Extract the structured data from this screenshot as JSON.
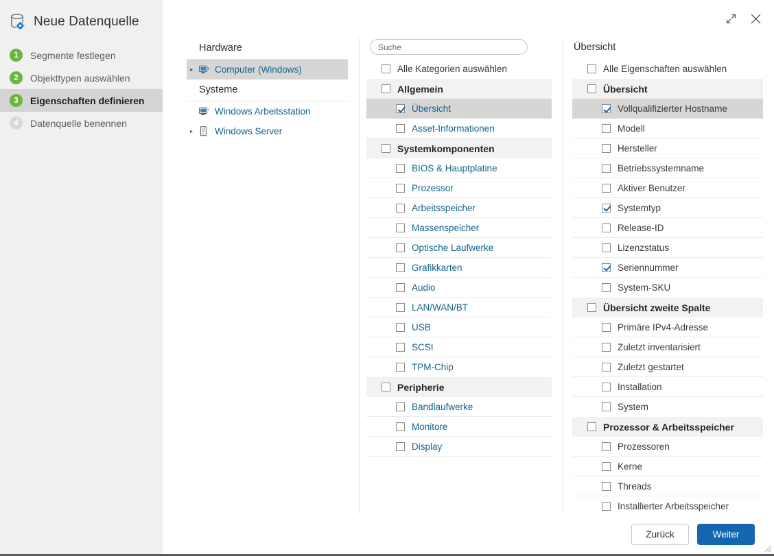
{
  "window": {
    "title": "Neue Datenquelle",
    "title_icon": "database-gear-icon",
    "maximize_icon": "maximize-icon",
    "close_icon": "close-icon"
  },
  "sidebar": {
    "steps": [
      {
        "number": "1",
        "label": "Segmente festlegen",
        "state": "done"
      },
      {
        "number": "2",
        "label": "Objekttypen auswählen",
        "state": "done"
      },
      {
        "number": "3",
        "label": "Eigenschaften definieren",
        "state": "active"
      },
      {
        "number": "4",
        "label": "Datenquelle benennen",
        "state": "pending"
      }
    ]
  },
  "tree": {
    "groups": [
      {
        "header": "Hardware",
        "items": [
          {
            "label": "Computer (Windows)",
            "icon": "computer-icon",
            "expander": "chevron-right",
            "selected": true
          }
        ]
      },
      {
        "header": "Systeme",
        "items": [
          {
            "label": "Windows Arbeitsstation",
            "icon": "computer-icon",
            "expander": "",
            "selected": false
          },
          {
            "label": "Windows Server",
            "icon": "server-icon",
            "expander": "chevron-right",
            "selected": false
          }
        ]
      }
    ]
  },
  "categories": {
    "search_placeholder": "Suche",
    "search_value": "",
    "select_all_label": "Alle Kategorien auswählen",
    "select_all_checked": false,
    "rows": [
      {
        "label": "Allgemein",
        "type": "group",
        "checked": false,
        "selected": false
      },
      {
        "label": "Übersicht",
        "type": "item",
        "checked": true,
        "selected": true
      },
      {
        "label": "Asset-Informationen",
        "type": "item",
        "checked": false,
        "selected": false
      },
      {
        "label": "Systemkomponenten",
        "type": "group",
        "checked": false,
        "selected": false
      },
      {
        "label": "BIOS & Hauptplatine",
        "type": "item",
        "checked": false,
        "selected": false
      },
      {
        "label": "Prozessor",
        "type": "item",
        "checked": false,
        "selected": false
      },
      {
        "label": "Arbeitsspeicher",
        "type": "item",
        "checked": false,
        "selected": false
      },
      {
        "label": "Massenspeicher",
        "type": "item",
        "checked": false,
        "selected": false
      },
      {
        "label": "Optische Laufwerke",
        "type": "item",
        "checked": false,
        "selected": false
      },
      {
        "label": "Grafikkarten",
        "type": "item",
        "checked": false,
        "selected": false
      },
      {
        "label": "Audio",
        "type": "item",
        "checked": false,
        "selected": false
      },
      {
        "label": "LAN/WAN/BT",
        "type": "item",
        "checked": false,
        "selected": false
      },
      {
        "label": "USB",
        "type": "item",
        "checked": false,
        "selected": false
      },
      {
        "label": "SCSI",
        "type": "item",
        "checked": false,
        "selected": false
      },
      {
        "label": "TPM-Chip",
        "type": "item",
        "checked": false,
        "selected": false
      },
      {
        "label": "Peripherie",
        "type": "group",
        "checked": false,
        "selected": false
      },
      {
        "label": "Bandlaufwerke",
        "type": "item",
        "checked": false,
        "selected": false
      },
      {
        "label": "Monitore",
        "type": "item",
        "checked": false,
        "selected": false
      },
      {
        "label": "Display",
        "type": "item",
        "checked": false,
        "selected": false
      }
    ]
  },
  "properties": {
    "title": "Übersicht",
    "select_all_label": "Alle Eigenschaften auswählen",
    "select_all_checked": false,
    "rows": [
      {
        "label": "Übersicht",
        "type": "group",
        "checked": false,
        "selected": false
      },
      {
        "label": "Vollqualifizierter Hostname",
        "type": "item",
        "checked": true,
        "selected": true
      },
      {
        "label": "Modell",
        "type": "item",
        "checked": false,
        "selected": false
      },
      {
        "label": "Hersteller",
        "type": "item",
        "checked": false,
        "selected": false
      },
      {
        "label": "Betriebssystemname",
        "type": "item",
        "checked": false,
        "selected": false
      },
      {
        "label": "Aktiver Benutzer",
        "type": "item",
        "checked": false,
        "selected": false
      },
      {
        "label": "Systemtyp",
        "type": "item",
        "checked": true,
        "selected": false
      },
      {
        "label": "Release-ID",
        "type": "item",
        "checked": false,
        "selected": false
      },
      {
        "label": "Lizenzstatus",
        "type": "item",
        "checked": false,
        "selected": false
      },
      {
        "label": "Seriennummer",
        "type": "item",
        "checked": true,
        "selected": false
      },
      {
        "label": "System-SKU",
        "type": "item",
        "checked": false,
        "selected": false
      },
      {
        "label": "Übersicht zweite Spalte",
        "type": "group",
        "checked": false,
        "selected": false
      },
      {
        "label": "Primäre IPv4-Adresse",
        "type": "item",
        "checked": false,
        "selected": false
      },
      {
        "label": "Zuletzt inventarisiert",
        "type": "item",
        "checked": false,
        "selected": false
      },
      {
        "label": "Zuletzt gestartet",
        "type": "item",
        "checked": false,
        "selected": false
      },
      {
        "label": "Installation",
        "type": "item",
        "checked": false,
        "selected": false
      },
      {
        "label": "System",
        "type": "item",
        "checked": false,
        "selected": false
      },
      {
        "label": "Prozessor & Arbeitsspeicher",
        "type": "group",
        "checked": false,
        "selected": false
      },
      {
        "label": "Prozessoren",
        "type": "item",
        "checked": false,
        "selected": false
      },
      {
        "label": "Kerne",
        "type": "item",
        "checked": false,
        "selected": false
      },
      {
        "label": "Threads",
        "type": "item",
        "checked": false,
        "selected": false
      },
      {
        "label": "Installierter Arbeitsspeicher",
        "type": "item",
        "checked": false,
        "selected": false
      }
    ]
  },
  "footer": {
    "back_label": "Zurück",
    "next_label": "Weiter"
  },
  "colors": {
    "accent_blue": "#1367b0",
    "link_blue": "#14628c",
    "step_green": "#6cb33f",
    "sidebar_bg": "#f0f0f0",
    "selected_row": "#d6d6d6",
    "group_row": "#f2f2f2"
  }
}
